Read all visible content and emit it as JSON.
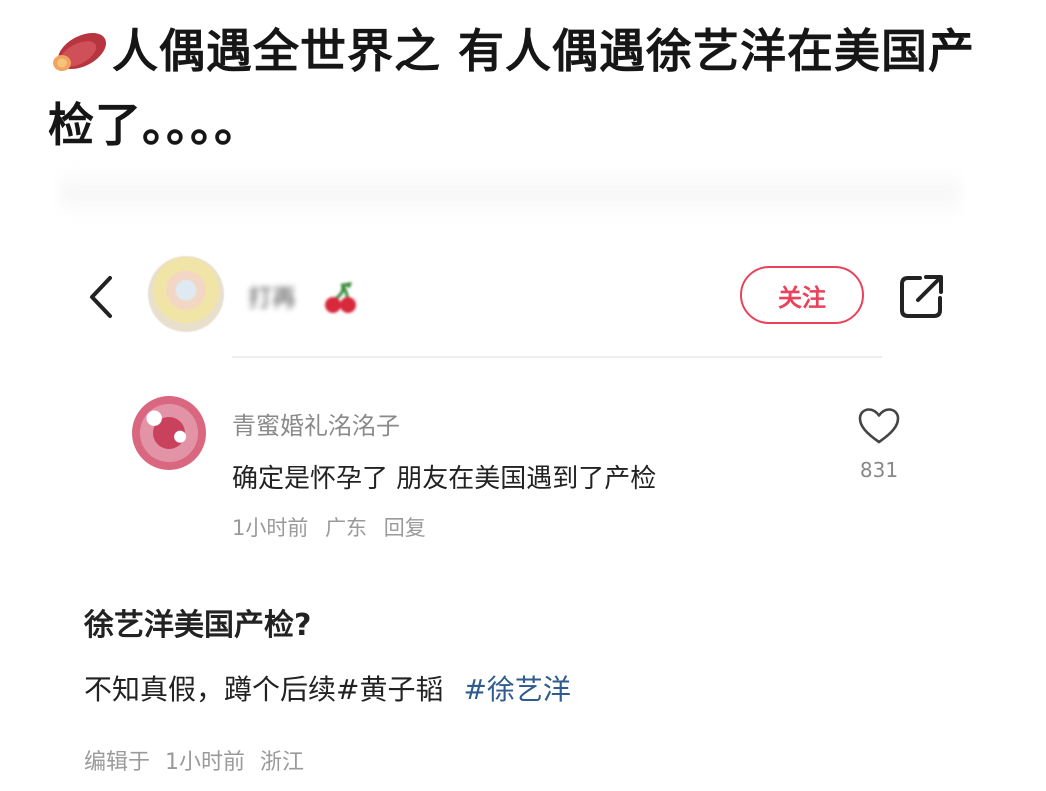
{
  "headline": {
    "emoji_icon": "sweet-potato-icon",
    "text": "人偶遇全世界之 有人偶遇徐艺洋在美国产检了。。。。"
  },
  "top_bar": {
    "back_icon": "chevron-left-icon",
    "username": "打再",
    "username_emoji": "cherry-icon",
    "follow_label": "关注",
    "share_icon": "share-icon",
    "accent_color": "#e8435a"
  },
  "comment": {
    "author": "青蜜婚礼洺洺子",
    "text": "确定是怀孕了 朋友在美国遇到了产检",
    "time": "1小时前",
    "location": "广东",
    "reply_label": "回复",
    "like_icon": "heart-outline-icon",
    "like_count": "831"
  },
  "post": {
    "title": "徐艺洋美国产检?",
    "body": "不知真假，蹲个后续#黄子韬",
    "tag": "#徐艺洋",
    "tag_color": "#2f5b8f",
    "edited_prefix": "编辑于",
    "edited_time": "1小时前",
    "edited_location": "浙江"
  }
}
